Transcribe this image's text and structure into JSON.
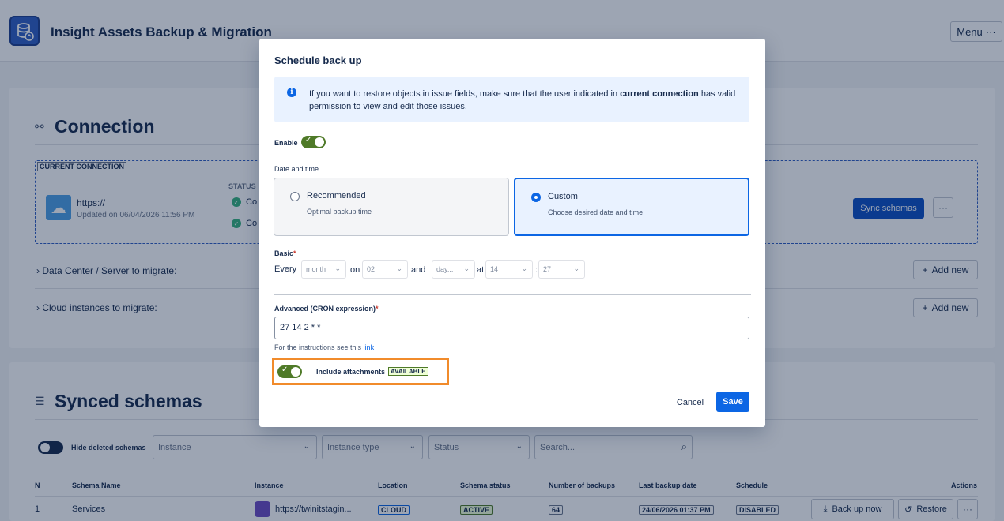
{
  "app": {
    "title": "Insight Assets Backup & Migration",
    "menu_label": "Menu",
    "menu_dots": "···"
  },
  "connection": {
    "title": "Connection",
    "current_label": "CURRENT CONNECTION",
    "url": "https://",
    "updated": "Updated on 06/04/2026 11:56 PM",
    "status_header": "STATUS",
    "status_1": "Co",
    "status_2": "Co",
    "sync_label": "Sync schemas",
    "more": "···",
    "dc_label": "Data Center / Server to migrate:",
    "cloud_label": "Cloud instances to migrate:",
    "add_new": "Add new"
  },
  "schemas": {
    "title": "Synced schemas",
    "hide_deleted": "Hide deleted schemas",
    "filters": {
      "instance": "Instance",
      "instance_type": "Instance type",
      "status": "Status",
      "search_placeholder": "Search..."
    },
    "columns": [
      "N",
      "Schema Name",
      "Instance",
      "Location",
      "Schema status",
      "Number of backups",
      "Last backup date",
      "Schedule",
      "Actions"
    ],
    "rows": [
      {
        "n": "1",
        "name": "Services",
        "instance": "https://twinitstagin...",
        "location": "CLOUD",
        "status": "ACTIVE",
        "backups": "64",
        "last_backup": "24/06/2026 01:37 PM",
        "schedule": "DISABLED"
      }
    ],
    "back_up_now": "Back up now",
    "restore": "Restore",
    "more": "···"
  },
  "modal": {
    "title": "Schedule back up",
    "info_pre": "If you want to restore objects in issue fields, make sure that the user indicated in ",
    "info_bold": "current connection",
    "info_post": " has valid permission to view and edit those issues.",
    "enable_label": "Enable",
    "date_time_label": "Date and time",
    "recommended_title": "Recommended",
    "recommended_sub": "Optimal backup time",
    "custom_title": "Custom",
    "custom_sub": "Choose desired date and time",
    "basic_label": "Basic",
    "every": "Every",
    "on": "on",
    "and": "and",
    "at": "at",
    "colon": ":",
    "sel_month": "month",
    "sel_day_num": "02",
    "sel_day": "day...",
    "sel_hour": "14",
    "sel_minute": "27",
    "advanced_label": "Advanced (CRON expression)",
    "cron_value": "27 14 2 * *",
    "instructions": "For the instructions see this ",
    "instructions_link": "link",
    "include_attachments": "Include attachments",
    "available": "AVAILABLE",
    "cancel": "Cancel",
    "save": "Save"
  }
}
